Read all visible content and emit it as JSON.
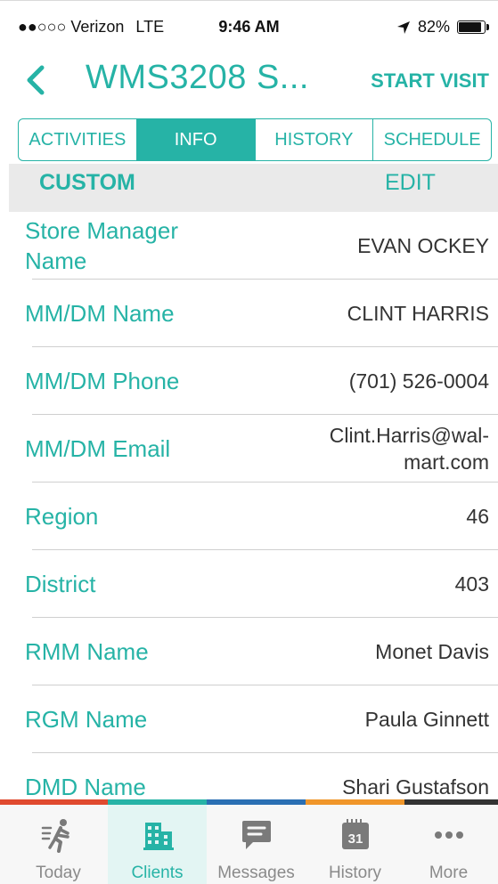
{
  "status_bar": {
    "carrier": "●●○○○ Verizon",
    "network": "LTE",
    "time": "9:46 AM",
    "battery": "82%",
    "battery_level": 0.82
  },
  "header": {
    "title": "WMS3208 S...",
    "action": "START VISIT"
  },
  "tabs": [
    {
      "label": "ACTIVITIES",
      "active": false
    },
    {
      "label": "INFO",
      "active": true
    },
    {
      "label": "HISTORY",
      "active": false
    },
    {
      "label": "SCHEDULE",
      "active": false
    }
  ],
  "subheader": {
    "custom": "CUSTOM",
    "edit": "EDIT"
  },
  "fields": [
    {
      "label": "Store Manager Name",
      "value": "EVAN OCKEY"
    },
    {
      "label": "MM/DM Name",
      "value": "CLINT HARRIS"
    },
    {
      "label": "MM/DM Phone",
      "value": "(701) 526-0004"
    },
    {
      "label": "MM/DM Email",
      "value": "Clint.Harris@wal-mart.com"
    },
    {
      "label": "Region",
      "value": "46"
    },
    {
      "label": "District",
      "value": "403"
    },
    {
      "label": "RMM Name",
      "value": "Monet Davis"
    },
    {
      "label": "RGM Name",
      "value": "Paula Ginnett"
    },
    {
      "label": "DMD Name",
      "value": "Shari Gustafson"
    }
  ],
  "tab_bar": {
    "items": [
      {
        "label": "Today",
        "icon": "walking-person-icon",
        "color": "#e04a2f",
        "active": false
      },
      {
        "label": "Clients",
        "icon": "building-icon",
        "color": "#26b3a6",
        "active": true
      },
      {
        "label": "Messages",
        "icon": "message-icon",
        "color": "#2a6fb3",
        "active": false
      },
      {
        "label": "History",
        "icon": "calendar-icon",
        "calendar_day": "31",
        "color": "#f0962a",
        "active": false
      },
      {
        "label": "More",
        "icon": "more-dots-icon",
        "color": "#333333",
        "active": false
      }
    ]
  },
  "colors": {
    "accent": "#26b3a6",
    "text": "#333333",
    "subheader_bg": "#eaeaea"
  }
}
